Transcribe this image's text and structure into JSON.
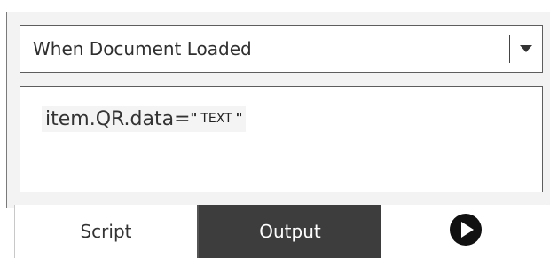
{
  "event_dropdown": {
    "selected": "When Document Loaded",
    "arrow_icon": "caret-down-icon"
  },
  "script_editor": {
    "code_prefix": "item.QR.data=",
    "open_quote": "\"",
    "string_value": "TEXT",
    "close_quote": "\""
  },
  "tabs": {
    "script_label": "Script",
    "output_label": "Output",
    "run_icon": "play-circle-icon"
  },
  "colors": {
    "active_tab_bg": "#3d3d3d",
    "active_tab_text": "#ffffff"
  }
}
